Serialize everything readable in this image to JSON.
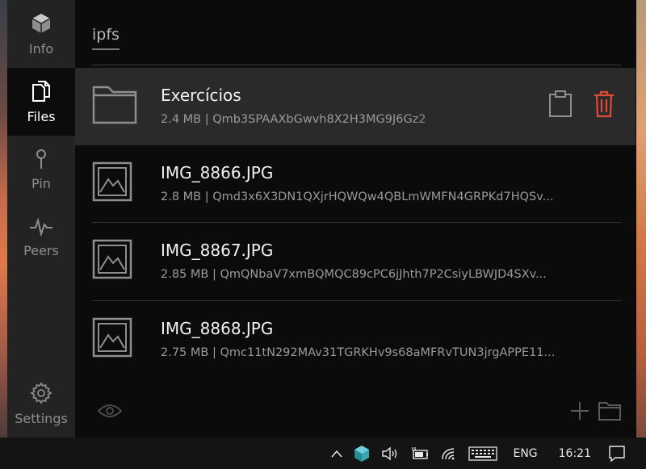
{
  "sidebar": {
    "items": [
      {
        "label": "Info",
        "icon": "cube-icon"
      },
      {
        "label": "Files",
        "icon": "files-icon"
      },
      {
        "label": "Pin",
        "icon": "pin-icon"
      },
      {
        "label": "Peers",
        "icon": "pulse-icon"
      }
    ],
    "settings_label": "Settings"
  },
  "main": {
    "breadcrumb": "ipfs",
    "files": [
      {
        "name": "Exercícios",
        "meta": "2.4 MB | Qmb3SPAAXbGwvh8X2H3MG9J6Gz2",
        "type": "folder"
      },
      {
        "name": "IMG_8866.JPG",
        "meta": "2.8 MB | Qmd3x6X3DN1QXjrHQWQw4QBLmWMFN4GRPKd7HQSv...",
        "type": "image"
      },
      {
        "name": "IMG_8867.JPG",
        "meta": "2.85 MB | QmQNbaV7xmBQMQC89cPC6jJhth7P2CsiyLBWJD4SXv...",
        "type": "image"
      },
      {
        "name": "IMG_8868.JPG",
        "meta": "2.75 MB | Qmc11tN292MAv31TGRKHv9s68aMFRvTUN3jrgAPPE11...",
        "type": "image"
      }
    ]
  },
  "taskbar": {
    "language": "ENG",
    "time": "16:21"
  },
  "colors": {
    "delete": "#e0483a",
    "sidebar_bg": "#232323",
    "main_bg": "#0b0b0b",
    "highlight_row": "#2a2a2a"
  }
}
